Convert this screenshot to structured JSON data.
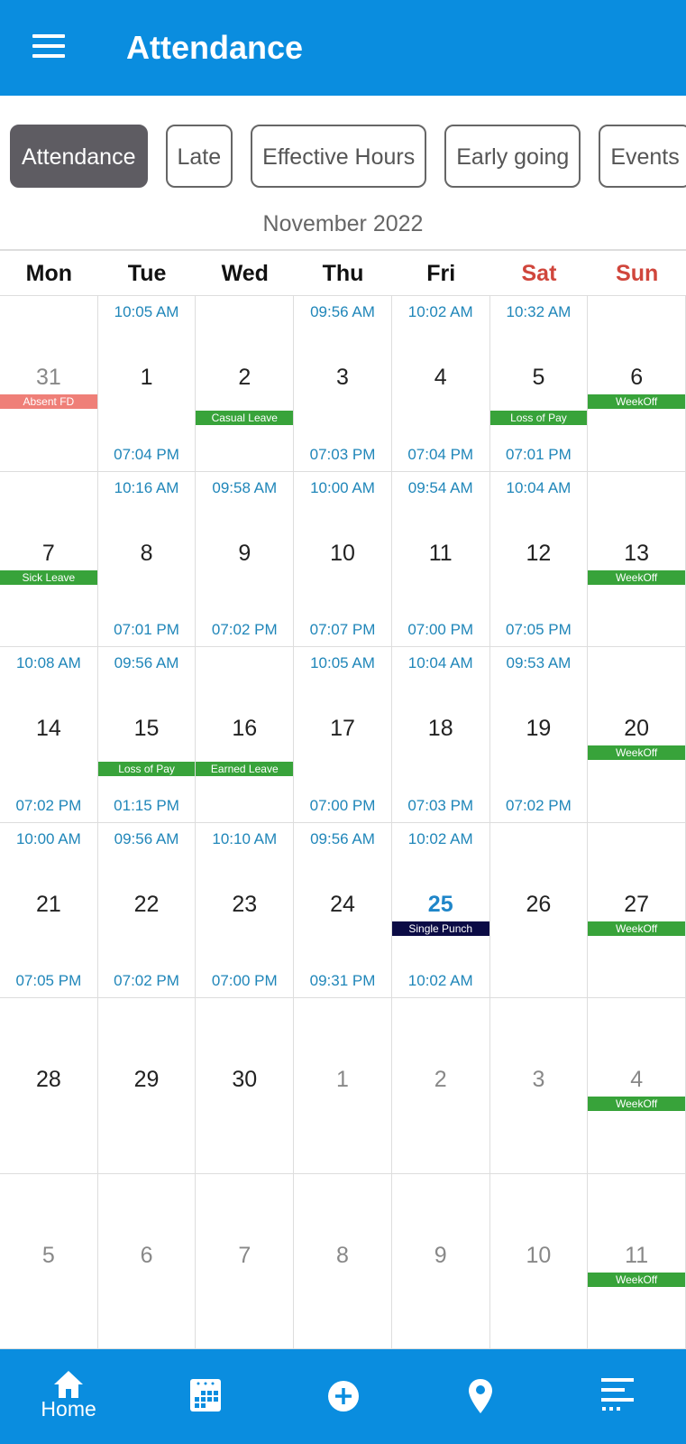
{
  "header": {
    "title": "Attendance",
    "menu_icon": "hamburger-icon"
  },
  "tabs": [
    {
      "label": "Attendance",
      "active": true
    },
    {
      "label": "Late"
    },
    {
      "label": "Effective Hours"
    },
    {
      "label": "Early going"
    },
    {
      "label": "Events"
    }
  ],
  "month_label": "November 2022",
  "weekdays": [
    {
      "label": "Mon"
    },
    {
      "label": "Tue"
    },
    {
      "label": "Wed"
    },
    {
      "label": "Thu"
    },
    {
      "label": "Fri"
    },
    {
      "label": "Sat",
      "weekend": true
    },
    {
      "label": "Sun",
      "weekend": true
    }
  ],
  "colors": {
    "primary": "#0a8ddf",
    "absent": "#ef7f78",
    "leave": "#38a33a",
    "single_punch": "#0b0b45",
    "weekend": "#c8463c",
    "time": "#1f86b9"
  },
  "days": [
    {
      "day": "31",
      "state": "muted",
      "badge": "Absent FD",
      "badge_type": "absent"
    },
    {
      "day": "1",
      "in": "10:05 AM",
      "out": "07:04 PM"
    },
    {
      "day": "2",
      "badge": "Casual Leave",
      "badge_type": "leave"
    },
    {
      "day": "3",
      "in": "09:56 AM",
      "out": "07:03 PM"
    },
    {
      "day": "4",
      "in": "10:02 AM",
      "out": "07:04 PM"
    },
    {
      "day": "5",
      "state": "weekend",
      "in": "10:32 AM",
      "out": "07:01 PM",
      "badge": "Loss of Pay",
      "badge_type": "leave"
    },
    {
      "day": "6",
      "state": "weekend",
      "badge": "WeekOff",
      "badge_type": "weekoff"
    },
    {
      "day": "7",
      "badge": "Sick Leave",
      "badge_type": "sick"
    },
    {
      "day": "8",
      "in": "10:16 AM",
      "out": "07:01 PM"
    },
    {
      "day": "9",
      "in": "09:58 AM",
      "out": "07:02 PM"
    },
    {
      "day": "10",
      "in": "10:00 AM",
      "out": "07:07 PM"
    },
    {
      "day": "11",
      "in": "09:54 AM",
      "out": "07:00 PM"
    },
    {
      "day": "12",
      "state": "weekend",
      "in": "10:04 AM",
      "out": "07:05 PM"
    },
    {
      "day": "13",
      "state": "weekend",
      "badge": "WeekOff",
      "badge_type": "weekoff"
    },
    {
      "day": "14",
      "in": "10:08 AM",
      "out": "07:02 PM"
    },
    {
      "day": "15",
      "in": "09:56 AM",
      "out": "01:15 PM",
      "badge": "Loss of Pay",
      "badge_type": "leave"
    },
    {
      "day": "16",
      "badge": "Earned Leave",
      "badge_type": "leave"
    },
    {
      "day": "17",
      "in": "10:05 AM",
      "out": "07:00 PM"
    },
    {
      "day": "18",
      "in": "10:04 AM",
      "out": "07:03 PM"
    },
    {
      "day": "19",
      "state": "weekend",
      "in": "09:53 AM",
      "out": "07:02 PM"
    },
    {
      "day": "20",
      "state": "weekend",
      "badge": "WeekOff",
      "badge_type": "weekoff"
    },
    {
      "day": "21",
      "in": "10:00 AM",
      "out": "07:05 PM"
    },
    {
      "day": "22",
      "in": "09:56 AM",
      "out": "07:02 PM"
    },
    {
      "day": "23",
      "in": "10:10 AM",
      "out": "07:00 PM"
    },
    {
      "day": "24",
      "in": "09:56 AM",
      "out": "09:31 PM"
    },
    {
      "day": "25",
      "state": "today",
      "in": "10:02 AM",
      "out": "10:02 AM",
      "badge": "Single Punch",
      "badge_type": "single"
    },
    {
      "day": "26",
      "state": "weekend"
    },
    {
      "day": "27",
      "state": "weekend",
      "badge": "WeekOff",
      "badge_type": "weekoff"
    },
    {
      "day": "28"
    },
    {
      "day": "29"
    },
    {
      "day": "30"
    },
    {
      "day": "1",
      "state": "muted"
    },
    {
      "day": "2",
      "state": "muted"
    },
    {
      "day": "3",
      "state": "muted"
    },
    {
      "day": "4",
      "state": "muted",
      "badge": "WeekOff",
      "badge_type": "weekoff"
    },
    {
      "day": "5",
      "state": "muted"
    },
    {
      "day": "6",
      "state": "muted"
    },
    {
      "day": "7",
      "state": "muted"
    },
    {
      "day": "8",
      "state": "muted"
    },
    {
      "day": "9",
      "state": "muted"
    },
    {
      "day": "10",
      "state": "muted"
    },
    {
      "day": "11",
      "state": "muted",
      "badge": "WeekOff",
      "badge_type": "weekoff"
    }
  ],
  "bottom_nav": [
    {
      "icon": "home-icon",
      "label": "Home"
    },
    {
      "icon": "calendar-icon"
    },
    {
      "icon": "add-circle-icon"
    },
    {
      "icon": "location-pin-icon"
    },
    {
      "icon": "more-list-icon"
    }
  ]
}
